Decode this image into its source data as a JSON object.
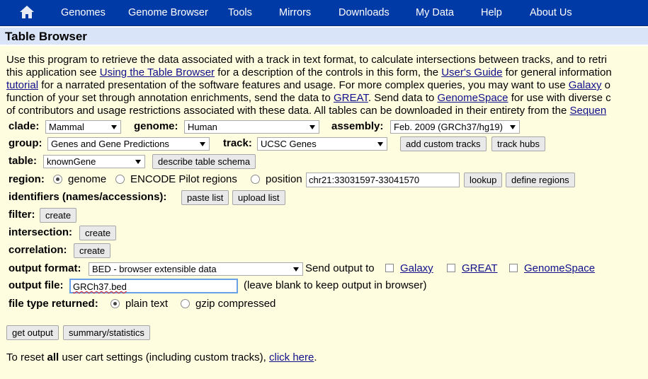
{
  "nav": {
    "items": [
      "Genomes",
      "Genome Browser",
      "Tools",
      "Mirrors",
      "Downloads",
      "My Data",
      "Help",
      "About Us"
    ]
  },
  "title": "Table Browser",
  "intro": {
    "l1": "Use this program to retrieve the data associated with a track in text format, to calculate intersections between tracks, and to retri",
    "l2a": "this application see ",
    "l2link": "Using the Table Browser",
    "l2b": " for a description of the controls in this form, the ",
    "l2link2": "User's Guide",
    "l2c": " for general information",
    "l3link": "tutorial",
    "l3b": " for a narrated presentation of the software features and usage. For more complex queries, you may want to use ",
    "l3link2": "Galaxy",
    "l3c": " o",
    "l4a": "function of your set through annotation enrichments, send the data to ",
    "l4link": "GREAT",
    "l4b": ". Send data to ",
    "l4link2": "GenomeSpace",
    "l4c": " for use with diverse c",
    "l5a": "of contributors and usage restrictions associated with these data. All tables can be downloaded in their entirety from the ",
    "l5link": "Sequen"
  },
  "form": {
    "clade_label": "clade:",
    "clade_value": "Mammal",
    "genome_label": "genome:",
    "genome_value": "Human",
    "assembly_label": "assembly:",
    "assembly_value": "Feb. 2009 (GRCh37/hg19)",
    "group_label": "group:",
    "group_value": "Genes and Gene Predictions",
    "track_label": "track:",
    "track_value": "UCSC Genes",
    "add_custom_tracks": "add custom tracks",
    "track_hubs": "track hubs",
    "table_label": "table:",
    "table_value": "knownGene",
    "describe_schema": "describe table schema",
    "region_label": "region:",
    "region_genome": "genome",
    "region_encode": "ENCODE Pilot regions",
    "region_position": "position",
    "position_value": "chr21:33031597-33041570",
    "lookup": "lookup",
    "define_regions": "define regions",
    "identifiers_label": "identifiers (names/accessions):",
    "paste_list": "paste list",
    "upload_list": "upload list",
    "filter_label": "filter:",
    "intersection_label": "intersection:",
    "correlation_label": "correlation:",
    "create": "create",
    "output_format_label": "output format:",
    "output_format_value": "BED - browser extensible data",
    "send_output_to": "Send output to",
    "galaxy": "Galaxy",
    "great": "GREAT",
    "genomespace": "GenomeSpace",
    "output_file_label": "output file:",
    "output_file_value": "GRCh37.bed",
    "output_file_hint": "(leave blank to keep output in browser)",
    "file_type_label": "file type returned:",
    "plain_text": "plain text",
    "gzip": "gzip compressed",
    "get_output": "get output",
    "summary": "summary/statistics"
  },
  "reset": {
    "a": "To reset ",
    "b": "all",
    "c": " user cart settings (including custom tracks), ",
    "link": "click here",
    "d": "."
  },
  "colors": {
    "navbar": "#003aa6",
    "titlebar": "#d9e4f8",
    "background": "#fffde0",
    "link": "#10108a"
  }
}
